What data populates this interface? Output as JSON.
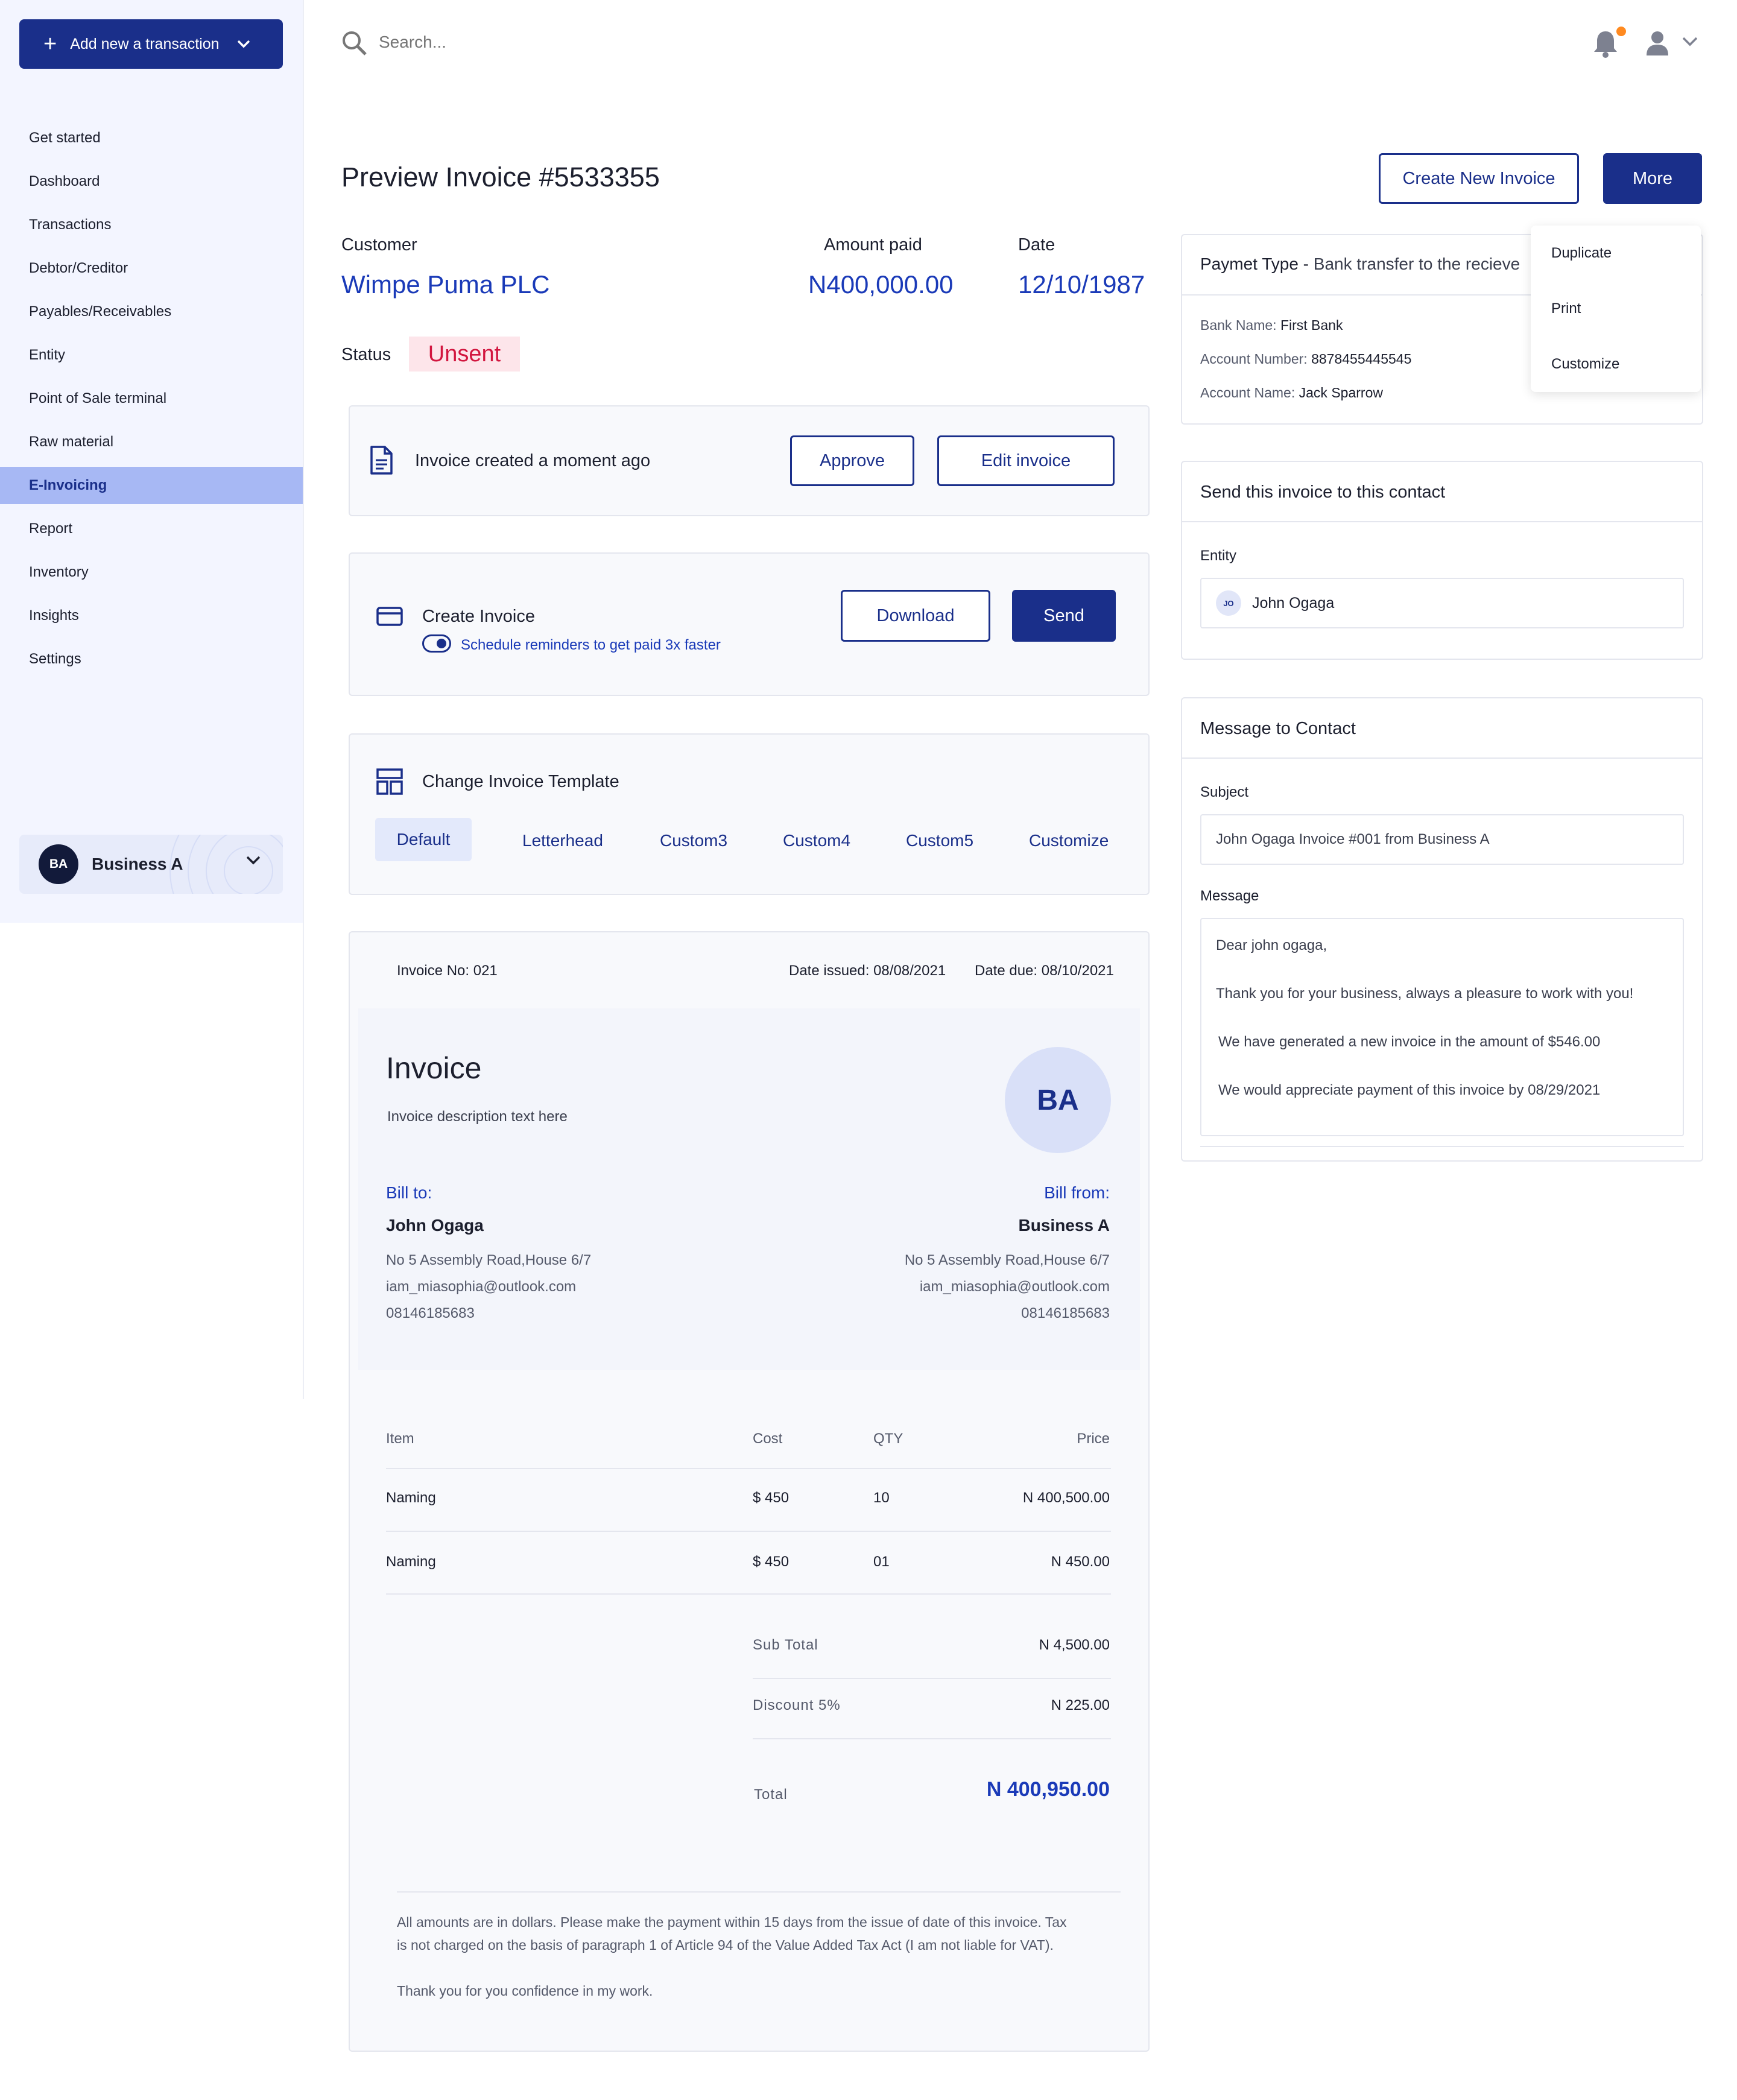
{
  "sidebar": {
    "add_button": "Add new a transaction",
    "items": [
      {
        "label": "Get started"
      },
      {
        "label": "Dashboard"
      },
      {
        "label": "Transactions"
      },
      {
        "label": "Debtor/Creditor"
      },
      {
        "label": "Payables/Receivables"
      },
      {
        "label": "Entity"
      },
      {
        "label": "Point of Sale terminal"
      },
      {
        "label": "Raw material"
      },
      {
        "label": "E-Invoicing"
      },
      {
        "label": "Report"
      },
      {
        "label": "Inventory"
      },
      {
        "label": "Insights"
      },
      {
        "label": "Settings"
      }
    ],
    "active_item": "E-Invoicing",
    "business": {
      "initials": "BA",
      "name": "Business A"
    }
  },
  "topbar": {
    "search_placeholder": "Search..."
  },
  "page": {
    "title": "Preview Invoice #5533355",
    "create_button": "Create New Invoice",
    "more_button": "More",
    "more_menu": [
      "Duplicate",
      "Print",
      "Customize"
    ]
  },
  "summary": {
    "customer_label": "Customer",
    "customer": "Wimpe Puma PLC",
    "amount_label": "Amount paid",
    "amount": "N400,000.00",
    "date_label": "Date",
    "date": "12/10/1987",
    "status_label": "Status",
    "status": "Unsent"
  },
  "created_card": {
    "text": "Invoice created a moment ago",
    "approve": "Approve",
    "edit": "Edit invoice"
  },
  "create_card": {
    "title": "Create Invoice",
    "reminder": "Schedule reminders to get paid 3x faster",
    "download": "Download",
    "send": "Send"
  },
  "template_card": {
    "title": "Change Invoice Template",
    "tabs": [
      "Default",
      "Letterhead",
      "Custom3",
      "Custom4",
      "Custom5",
      "Customize"
    ]
  },
  "invoice": {
    "number": "Invoice No: 021",
    "date_issued": "Date issued: 08/08/2021",
    "date_due": "Date due: 08/10/2021",
    "heading": "Invoice",
    "description": "Invoice description text here",
    "logo": "BA",
    "bill_to_label": "Bill to:",
    "bill_to": {
      "name": "John Ogaga",
      "address": "No 5 Assembly Road,House 6/7",
      "email": "iam_miasophia@outlook.com",
      "phone": "08146185683"
    },
    "bill_from_label": "Bill from:",
    "bill_from": {
      "name": "Business A",
      "address": "No 5 Assembly Road,House 6/7",
      "email": "iam_miasophia@outlook.com",
      "phone": "08146185683"
    },
    "columns": [
      "Item",
      "Cost",
      "QTY",
      "Price"
    ],
    "rows": [
      {
        "item": "Naming",
        "cost": "$ 450",
        "qty": "10",
        "price": "N 400,500.00"
      },
      {
        "item": "Naming",
        "cost": "$ 450",
        "qty": "01",
        "price": "N 450.00"
      }
    ],
    "subtotal_label": "Sub Total",
    "subtotal": "N 4,500.00",
    "discount_label": "Discount 5%",
    "discount": "N 225.00",
    "total_label": "Total",
    "total": "N 400,950.00",
    "note1": "All amounts are in dollars. Please make the payment within 15 days from the issue of date of this invoice. Tax",
    "note2": "is not charged on the basis of paragraph 1 of Article 94 of the Value Added Tax Act (I am not liable for VAT).",
    "note3": "Thank you for you confidence in my work."
  },
  "payment": {
    "type_label": "Paymet Type -",
    "type_value": "Bank transfer to the recieve",
    "bank_label": "Bank Name:",
    "bank": "First Bank",
    "account_label": "Account Number:",
    "account": "8878455445545",
    "account_name_label": "Account Name:",
    "account_name": "Jack Sparrow"
  },
  "send_contact": {
    "title": "Send this invoice to this contact",
    "entity_label": "Entity",
    "entity_initials": "JO",
    "entity": "John Ogaga"
  },
  "message": {
    "title": "Message to Contact",
    "subject_label": "Subject",
    "subject": "John Ogaga Invoice #001 from Business A",
    "message_label": "Message",
    "lines": [
      "Dear john ogaga,",
      "Thank you for your business, always a pleasure to work with you!",
      "We have generated a new invoice in the amount of $546.00",
      "We would appreciate payment of this invoice by 08/29/2021"
    ]
  },
  "colors": {
    "primary": "#1a2f8a",
    "accent": "#1a3ab8",
    "status_bg": "#fde5ea",
    "status_text": "#d2163f",
    "active_nav": "#a7b8f4",
    "notification_dot": "#ff8a20"
  }
}
